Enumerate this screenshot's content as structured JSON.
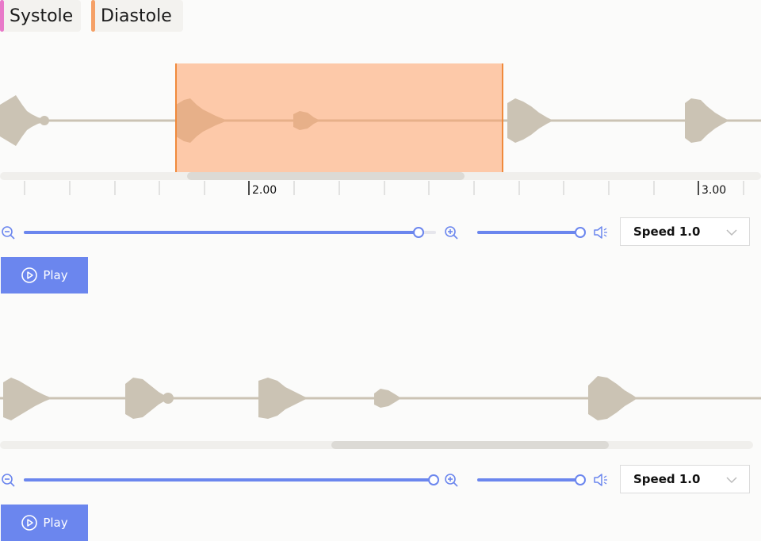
{
  "labels": [
    {
      "text": "Systole",
      "color": "#e879c9"
    },
    {
      "text": "Diastole",
      "color": "#f5a066"
    }
  ],
  "player1": {
    "tick_labels": [
      "2.00",
      "3.00"
    ],
    "speed_label": "Speed 1.0",
    "play_label": "Play"
  },
  "player2": {
    "speed_label": "Speed 1.0",
    "play_label": "Play"
  },
  "colors": {
    "waveform": "#cbc3b4",
    "accent": "#6b86ee",
    "region": "#ffa066"
  },
  "icons": [
    "zoom-out-icon",
    "zoom-in-icon",
    "volume-icon",
    "chevron-down-icon",
    "play-circle-icon"
  ]
}
